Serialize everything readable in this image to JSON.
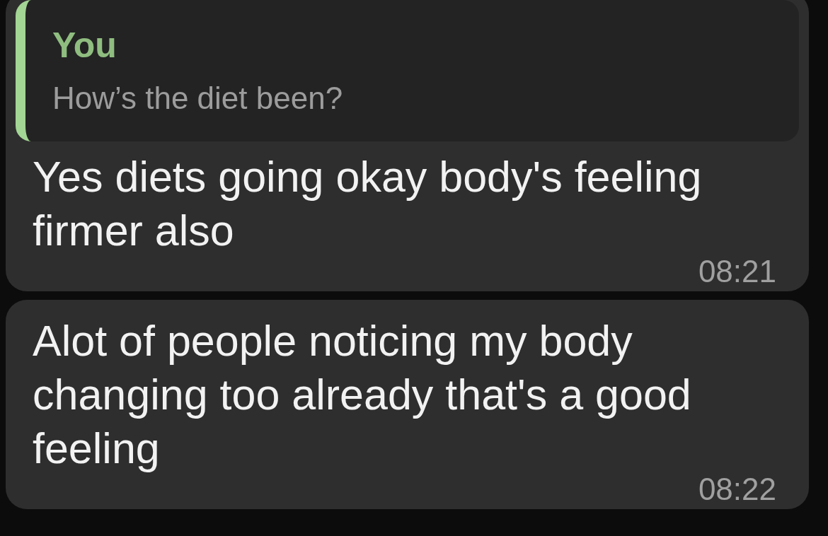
{
  "messages": [
    {
      "quote": {
        "author": "You",
        "text": "How’s the diet been?"
      },
      "text": "Yes diets going okay body's feeling firmer also",
      "time": "08:21"
    },
    {
      "text": "Alot of people noticing my body changing too already that's a good feeling",
      "time": "08:22"
    }
  ]
}
